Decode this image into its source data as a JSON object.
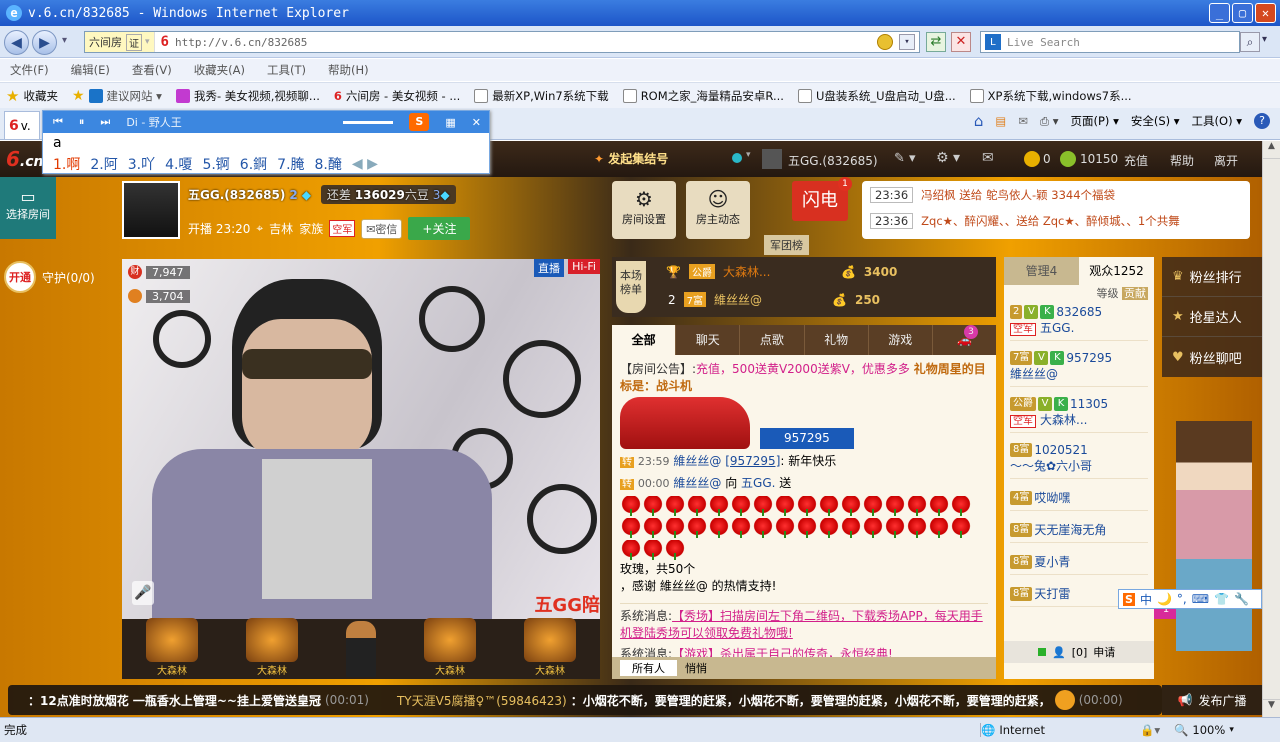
{
  "window": {
    "title": "v.6.cn/832685 - Windows Internet Explorer",
    "min": "_",
    "max": "▢",
    "close": "✕"
  },
  "address": {
    "site_tag": "六间房",
    "cert": "证",
    "url": "http://v.6.cn/832685",
    "search_placeholder": "Live Search"
  },
  "menu": [
    "文件(F)",
    "编辑(E)",
    "查看(V)",
    "收藏夹(A)",
    "工具(T)",
    "帮助(H)"
  ],
  "favorites": {
    "label": "收藏夹",
    "items": [
      "建议网站 ▾",
      "我秀- 美女视频,视频聊...",
      "六间房 - 美女视频 - ...",
      "最新XP,Win7系统下载",
      "ROM之家_海量精品安卓R...",
      "U盘装系统_U盘启动_U盘...",
      "XP系统下载,windows7系..."
    ]
  },
  "tab": {
    "label": "v.",
    "media_title": "Di - 野人王"
  },
  "ie_cmd": [
    "页面(P) ▾",
    "安全(S) ▾",
    "工具(O) ▾"
  ],
  "ime": {
    "input": "a",
    "candidates": [
      "1.啊",
      "2.阿",
      "3.吖",
      "4.嗄",
      "5.锕",
      "6.錒",
      "7.腌",
      "8.醃"
    ]
  },
  "site": {
    "logo": "6.cn",
    "top_promo": "发起集结号",
    "user_name": "五GG.(832685)",
    "coins": "0",
    "beans": "10150",
    "recharge": "充值",
    "help": "帮助",
    "leave": "离开",
    "select_room": "选择房间"
  },
  "host": {
    "name": "五GG.(832685)",
    "level_num": "2",
    "gap_label": "还差",
    "gap_value": "136029",
    "gap_unit": "六豆",
    "next_level": "3",
    "start_time": "开播 23:20",
    "location": "吉林",
    "family_label": "家族",
    "family_badge": "空军",
    "message_btn": "密信",
    "follow_btn": "+关注"
  },
  "room_buttons": {
    "settings": "房间设置",
    "host_news": "房主动态"
  },
  "flash": {
    "label": "闪电",
    "count": "1",
    "sub": "军团榜"
  },
  "ticker": [
    {
      "time": "23:36",
      "text": "冯绍枫 送给 鸵鸟依人-颖 3344个福袋"
    },
    {
      "time": "23:36",
      "text": "Zqc★、醉闪耀、、送给 Zqc★、醉倾城、、1个共舞"
    }
  ],
  "guard": {
    "open_btn": "开通",
    "label": "守护(0/0)"
  },
  "video": {
    "wealth": "7,947",
    "charm": "3,704",
    "live_tag": "直播",
    "hifi_tag": "Hi-Fi",
    "watermark": "五GG陪"
  },
  "seats": [
    "大森林",
    "大森林",
    "大森林",
    "大森林",
    "大森林"
  ],
  "ranking": {
    "tag": "本场榜单",
    "rows": [
      {
        "rank": "1",
        "badge": "公爵",
        "name": "大森林...",
        "value": "3400"
      },
      {
        "rank": "2",
        "badge": "7富",
        "name": "維丝丝@",
        "value": "250"
      }
    ]
  },
  "chat_tabs": [
    "全部",
    "聊天",
    "点歌",
    "礼物",
    "游戏",
    "3"
  ],
  "chat": {
    "notice_label": "【房间公告】:",
    "notice_text": "充值，500送黄V2000送紫V，优惠多多",
    "notice_tail": "礼物周星的目标是：战斗机",
    "car_id": "957295",
    "msg1": {
      "tag": "转",
      "time": "23:59",
      "user": "維丝丝@",
      "uid": "[957295]",
      "text": ": 新年快乐"
    },
    "msg2": {
      "tag": "转",
      "time": "00:00",
      "user": "維丝丝@",
      "to": "向",
      "target": "五GG.",
      "verb": "送"
    },
    "rose_suffix": "玫瑰，共50个",
    "thanks": "，感谢 維丝丝@ 的热情支持!",
    "sys1_label": "系统消息:",
    "sys1_text": "【秀场】扫描房间左下角二维码，下载秀场APP，每天用手机登陆秀场可以领取免费礼物哦!",
    "sys2_label": "系统消息:",
    "sys2_text": "【游戏】杀出属于自己的传奇，永恒经典!",
    "input_target": "所有人",
    "hidden_label": "悄悄"
  },
  "audience": {
    "admin_tab": "管理4",
    "viewers_tab": "观众1252",
    "sort_level": "等级",
    "sort_contrib": "贡献",
    "list": [
      {
        "level": "2",
        "name": "832685",
        "sub": "五GG.",
        "badge": "空军"
      },
      {
        "level": "7富",
        "name": "957295",
        "sub": "維丝丝@",
        "badge": ""
      },
      {
        "level": "公爵",
        "name": "11305",
        "sub": "大森林...",
        "badge": "空军"
      },
      {
        "level": "8富",
        "name": "1020521",
        "sub": "～～兔✿六小哥",
        "badge": ""
      },
      {
        "level": "4富",
        "name": "哎呦嘿",
        "sub": "",
        "badge": ""
      },
      {
        "level": "8富",
        "name": "天无崖海无角",
        "sub": "",
        "badge": ""
      },
      {
        "level": "8富",
        "name": "夏小青",
        "sub": "",
        "badge": ""
      },
      {
        "level": "8富",
        "name": "天打雷",
        "sub": "",
        "badge": ""
      }
    ],
    "apply_count": "1",
    "apply_btn": "申请",
    "mic_count": "[0]"
  },
  "side_menu": [
    "粉丝排行",
    "抢星达人",
    "粉丝聊吧"
  ],
  "side_badge": "40",
  "marquee": {
    "left": "：12点准时放烟花 一瓶香水上管理~~挂上爱管送皇冠",
    "left_time": "(00:01)",
    "right_user": "TY天涯V5腐播♀™(59846423)",
    "right_text": "：小烟花不断，要管理的赶紧，小烟花不断，要管理的赶紧，小烟花不断，要管理的赶紧，",
    "right_time": "(00:00)",
    "broadcast_btn": "发布广播"
  },
  "ime_status": [
    "中",
    "🌙",
    "°,",
    "⌨",
    "👕",
    "🔧"
  ],
  "status": {
    "left": "完成",
    "zone": "Internet",
    "zoom": "100%"
  }
}
